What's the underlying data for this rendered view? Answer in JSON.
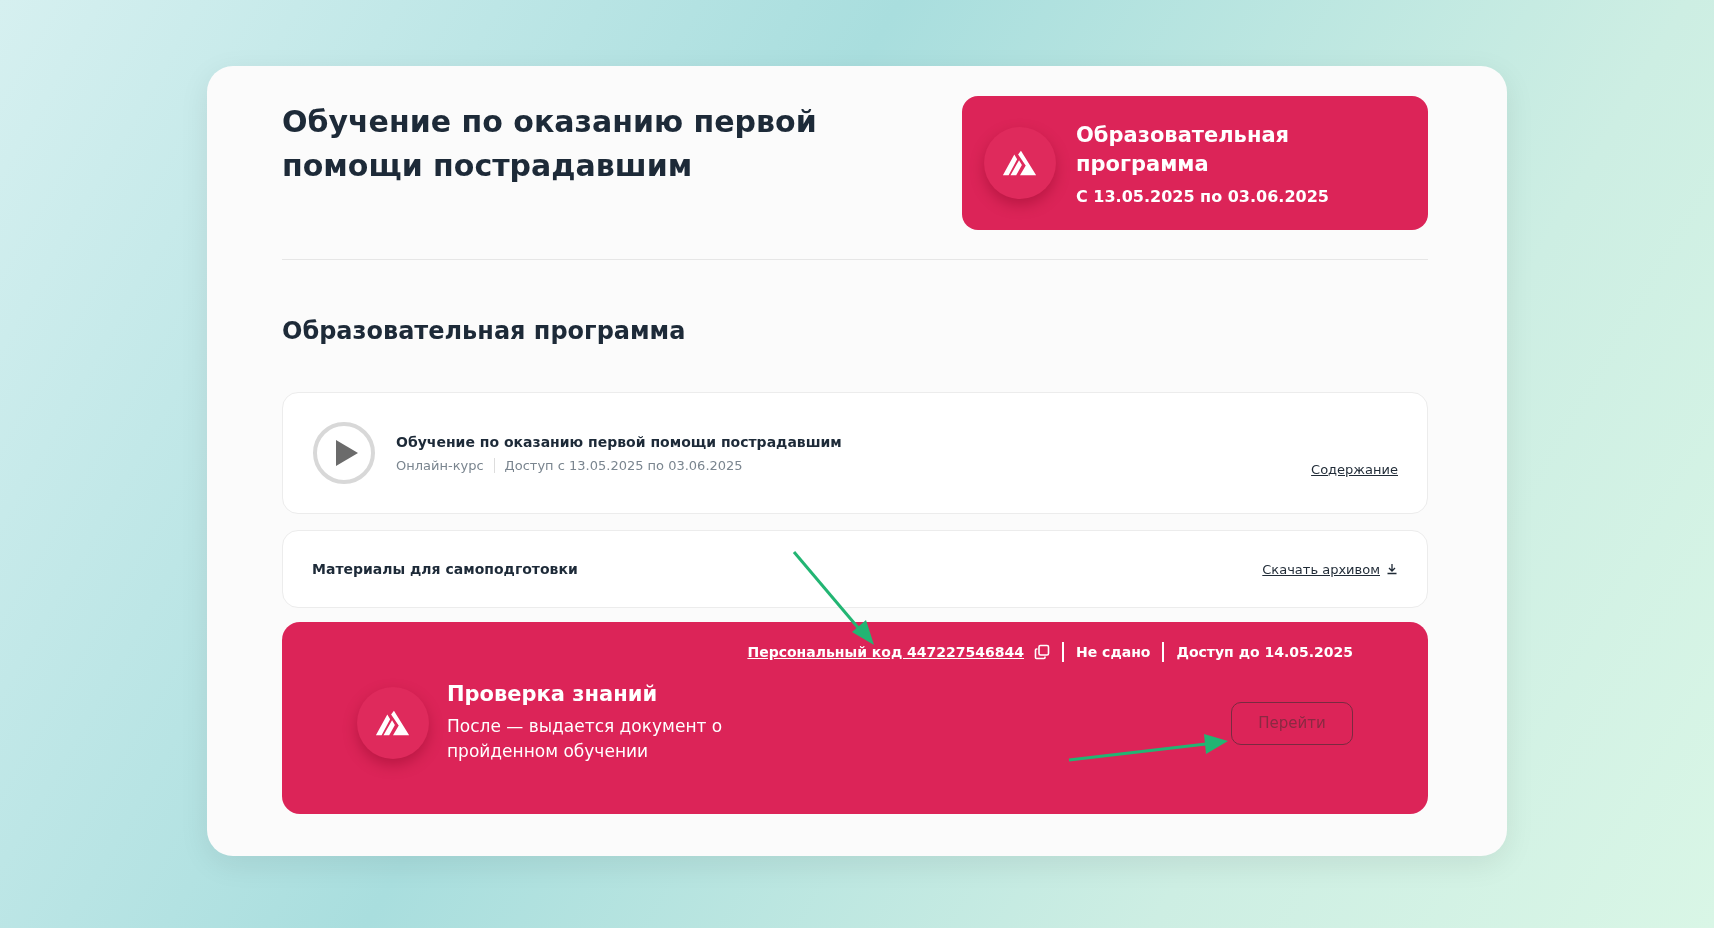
{
  "header": {
    "title": "Обучение по оказанию первой помощи пострадавшим",
    "banner": {
      "title": "Образовательная программа",
      "dates": "С 13.05.2025 по 03.06.2025"
    }
  },
  "section_title": "Образовательная программа",
  "course": {
    "title": "Обучение по оказанию первой помощи пострадавшим",
    "type": "Онлайн-курс",
    "access": "Доступ с 13.05.2025 по 03.06.2025",
    "link": "Содержание"
  },
  "materials": {
    "title": "Материалы для самоподготовки",
    "link": "Скачать архивом"
  },
  "test": {
    "code_link": "Персональный код 447227546844",
    "status": "Не сдано",
    "access": "Доступ до 14.05.2025",
    "title": "Проверка знаний",
    "description": "После — выдается документ о пройденном обучении",
    "button": {
      "label": "Перейти",
      "disabled": true
    }
  }
}
